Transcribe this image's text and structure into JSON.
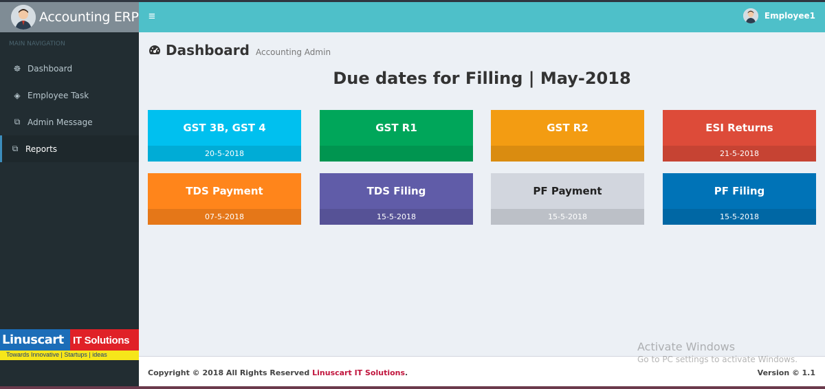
{
  "app": {
    "title": "Accounting ERP",
    "user_name": "Employee1"
  },
  "sidebar": {
    "header": "MAIN NAVIGATION",
    "items": [
      {
        "label": "Dashboard",
        "icon": "dashboard-icon",
        "glyph": "☸"
      },
      {
        "label": "Employee Task",
        "icon": "tasks-icon",
        "glyph": "◈"
      },
      {
        "label": "Admin Message",
        "icon": "message-icon",
        "glyph": "⧉"
      },
      {
        "label": "Reports",
        "icon": "reports-icon",
        "glyph": "⧉"
      }
    ],
    "active_item": "Reports"
  },
  "brand": {
    "name_a": "Linuscart",
    "name_b": "IT Solutions",
    "tagline": "Towards Innovative | Startups | ideas"
  },
  "content": {
    "page_title": "Dashboard",
    "page_subtitle": "Accounting Admin",
    "due_title": "Due dates for Filling | May-2018"
  },
  "boxes": [
    {
      "title": "GST 3B, GST 4",
      "date": "20-5-2018",
      "color": "#00c0ef"
    },
    {
      "title": "GST R1",
      "date": "",
      "color": "#00a65a"
    },
    {
      "title": "GST R2",
      "date": "",
      "color": "#f39c12"
    },
    {
      "title": "ESI Returns",
      "date": "21-5-2018",
      "color": "#dd4b39"
    },
    {
      "title": "TDS Payment",
      "date": "07-5-2018",
      "color": "#ff851b"
    },
    {
      "title": "TDS Filing",
      "date": "15-5-2018",
      "color": "#605ca8"
    },
    {
      "title": "PF Payment",
      "date": "15-5-2018",
      "color": "#d2d6de"
    },
    {
      "title": "PF Filing",
      "date": "15-5-2018",
      "color": "#0073b7"
    }
  ],
  "footer": {
    "copyright_prefix": "Copyright © 2018 All Rights Reserved",
    "company": "Linuscart IT Solutions",
    "period": ".",
    "version_label": "Version ©",
    "version_number": "1.1"
  },
  "watermark": {
    "line1": "Activate Windows",
    "line2": "Go to PC settings to activate Windows."
  }
}
